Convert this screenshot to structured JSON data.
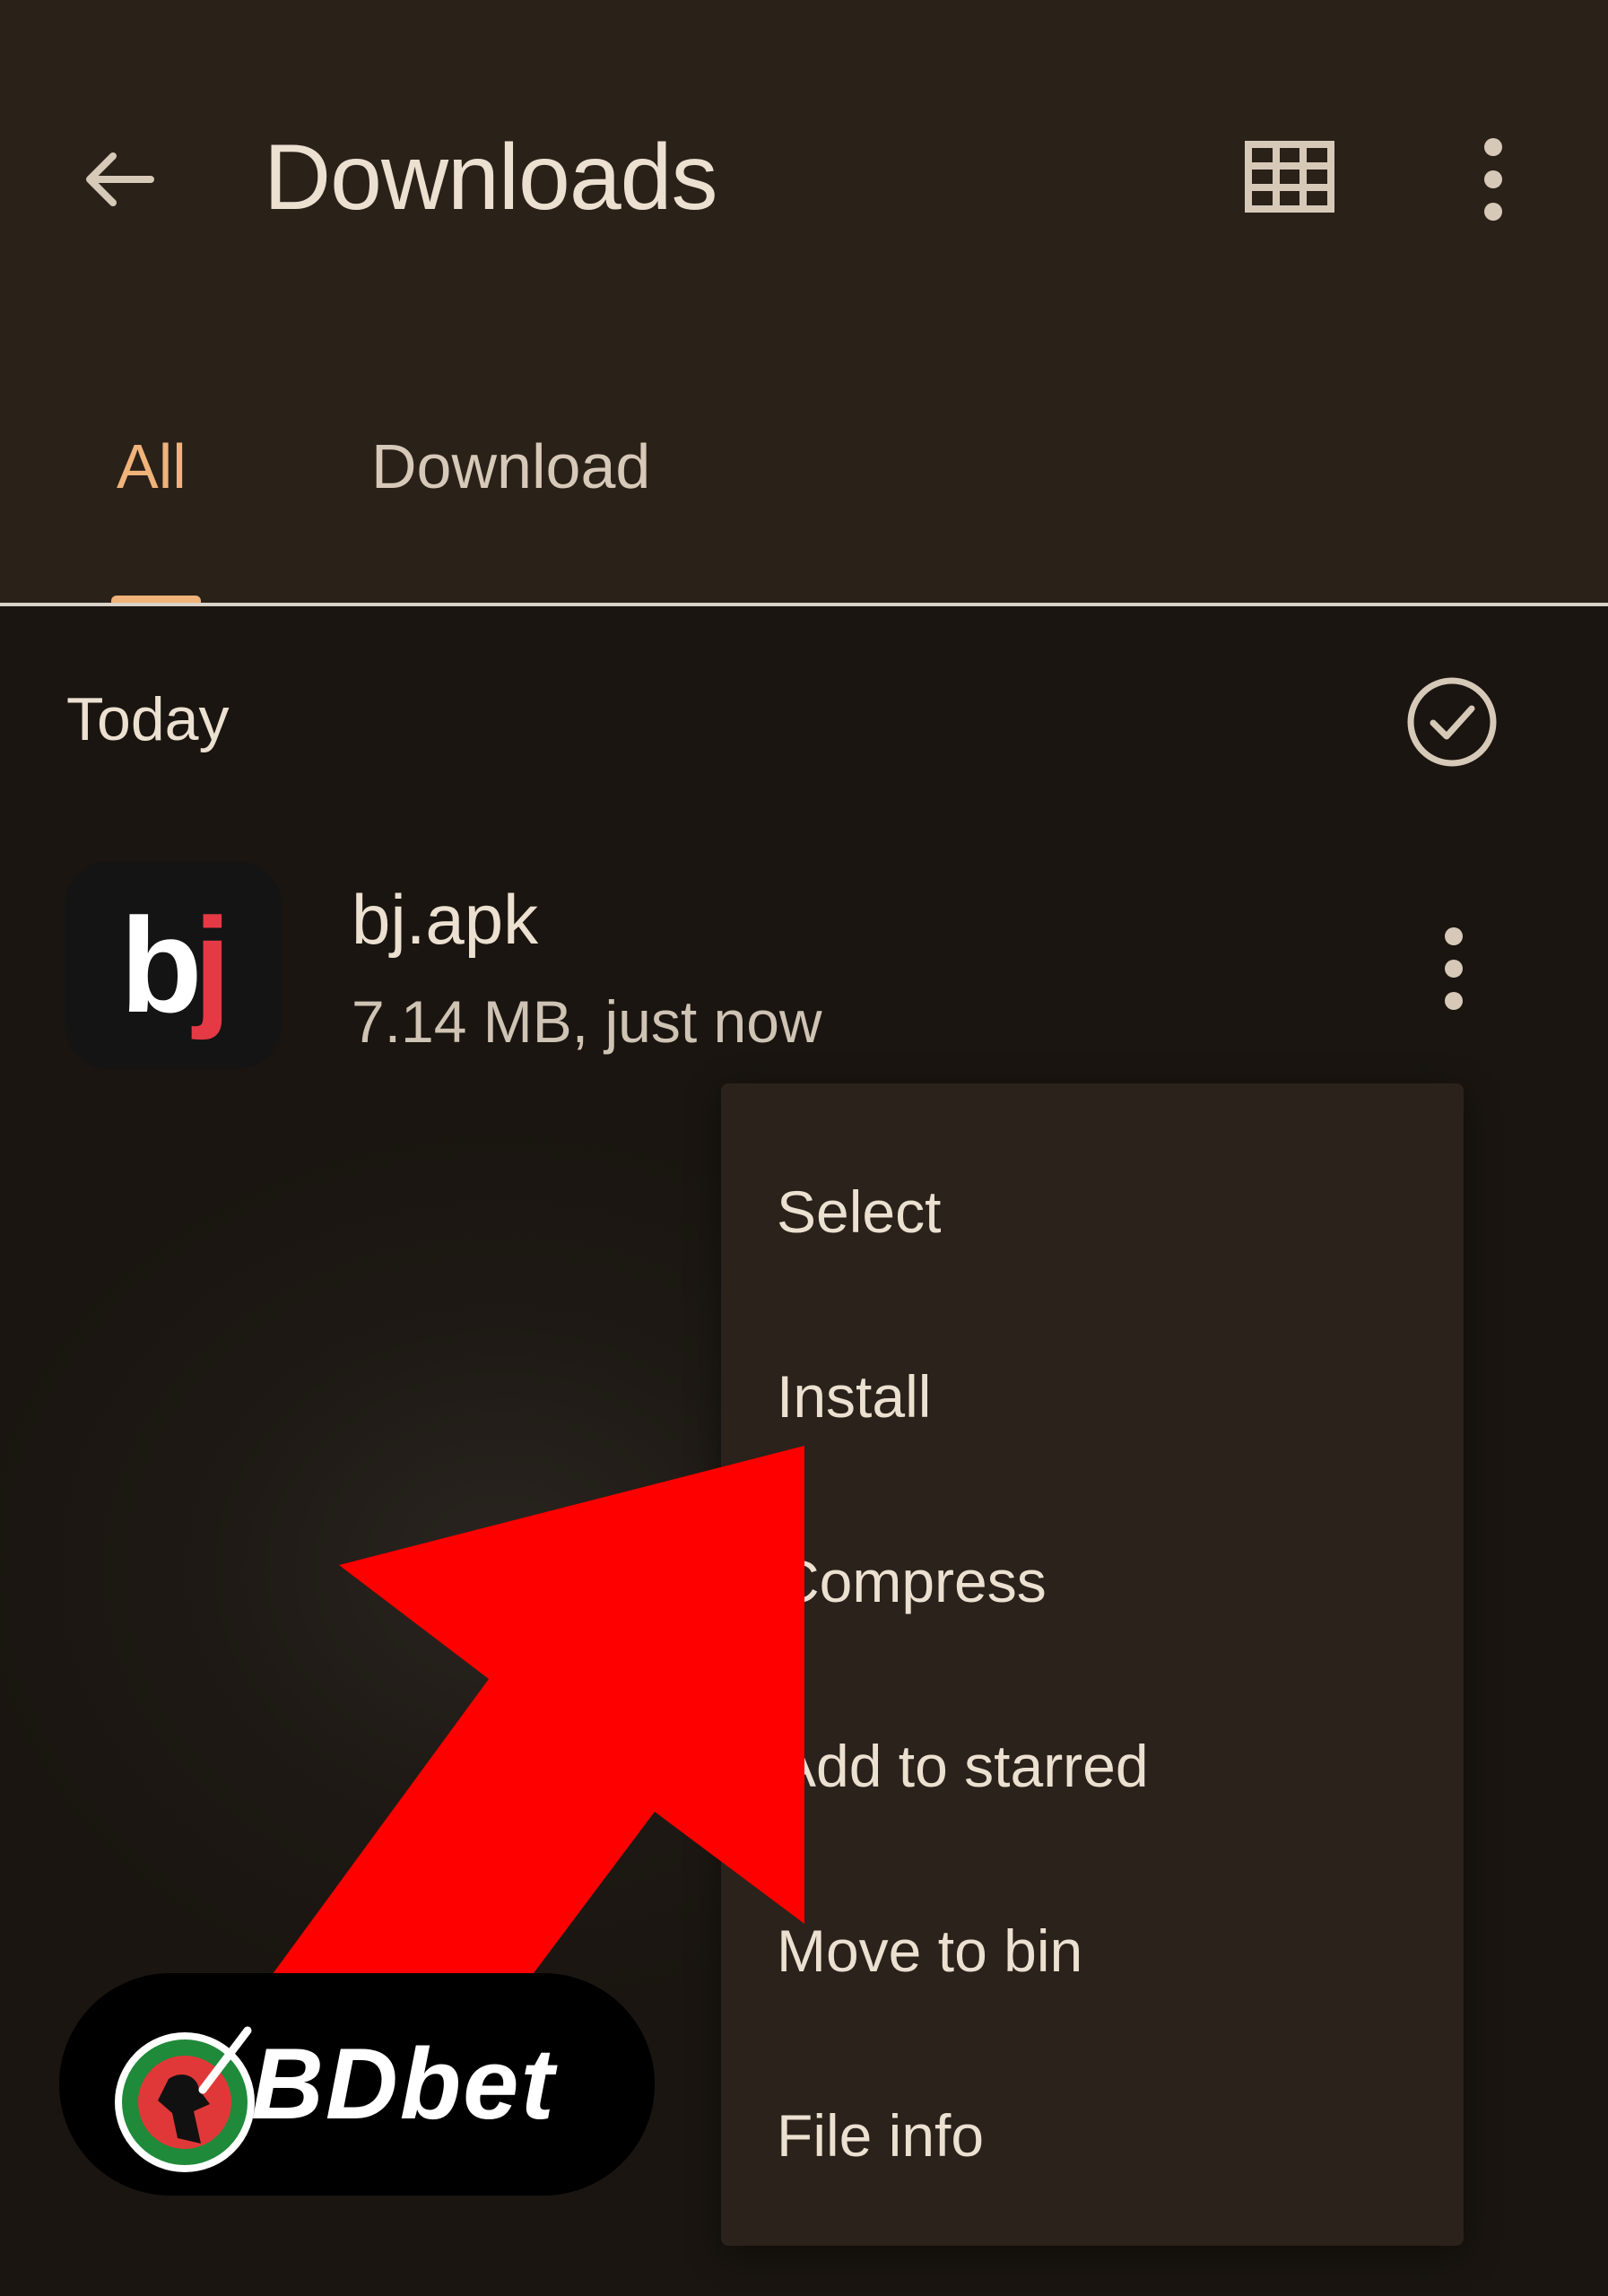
{
  "header": {
    "title": "Downloads",
    "back_icon": "arrow-back-icon",
    "view_icon": "grid-view-icon",
    "menu_icon": "more-vert-icon"
  },
  "tabs": [
    {
      "label": "All",
      "active": true
    },
    {
      "label": "Download",
      "active": false
    }
  ],
  "section": {
    "label": "Today",
    "select_all_icon": "check-circle-icon"
  },
  "file": {
    "name": "bj.apk",
    "meta": "7.14 MB, just now",
    "app_icon_text": "bj",
    "menu_icon": "more-vert-icon"
  },
  "context_menu": {
    "items": [
      "Select",
      "Install",
      "Compress",
      "Add to starred",
      "Move to bin",
      "File info"
    ]
  },
  "overlay": {
    "arrow_icon": "red-pointer-arrow",
    "logo_text": "BDbet"
  },
  "colors": {
    "accent": "#f0b37a",
    "background": "#1a1510",
    "topbar": "#2a2119",
    "menu": "#2a221b",
    "text": "#ece0d1",
    "arrow": "#ff0000"
  }
}
